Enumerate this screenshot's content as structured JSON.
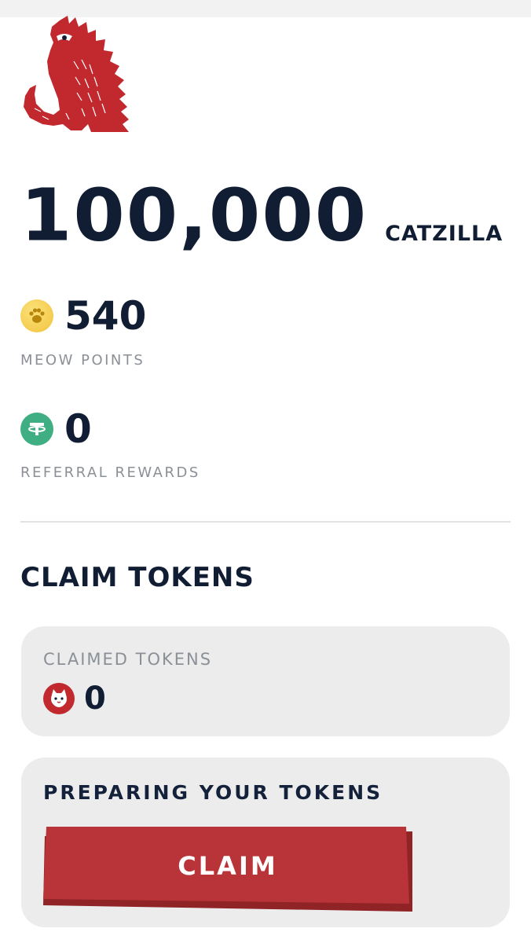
{
  "header": {
    "logo_icon": "catzilla-logo-icon",
    "brand_color": "#c1292e"
  },
  "balance": {
    "amount": "100,000",
    "unit": "CATZILLA"
  },
  "meow_points": {
    "icon": "paw-coin-icon",
    "value": "540",
    "label": "MEOW POINTS"
  },
  "referral_rewards": {
    "icon": "tether-coin-icon",
    "value": "0",
    "label": "REFERRAL REWARDS"
  },
  "claim_section": {
    "title": "CLAIM TOKENS",
    "claimed": {
      "label": "CLAIMED TOKENS",
      "icon": "catzilla-token-icon",
      "value": "0"
    },
    "status": {
      "label": "PREPARING YOUR TOKENS",
      "button_label": "CLAIM",
      "button_color": "#b83438"
    }
  }
}
